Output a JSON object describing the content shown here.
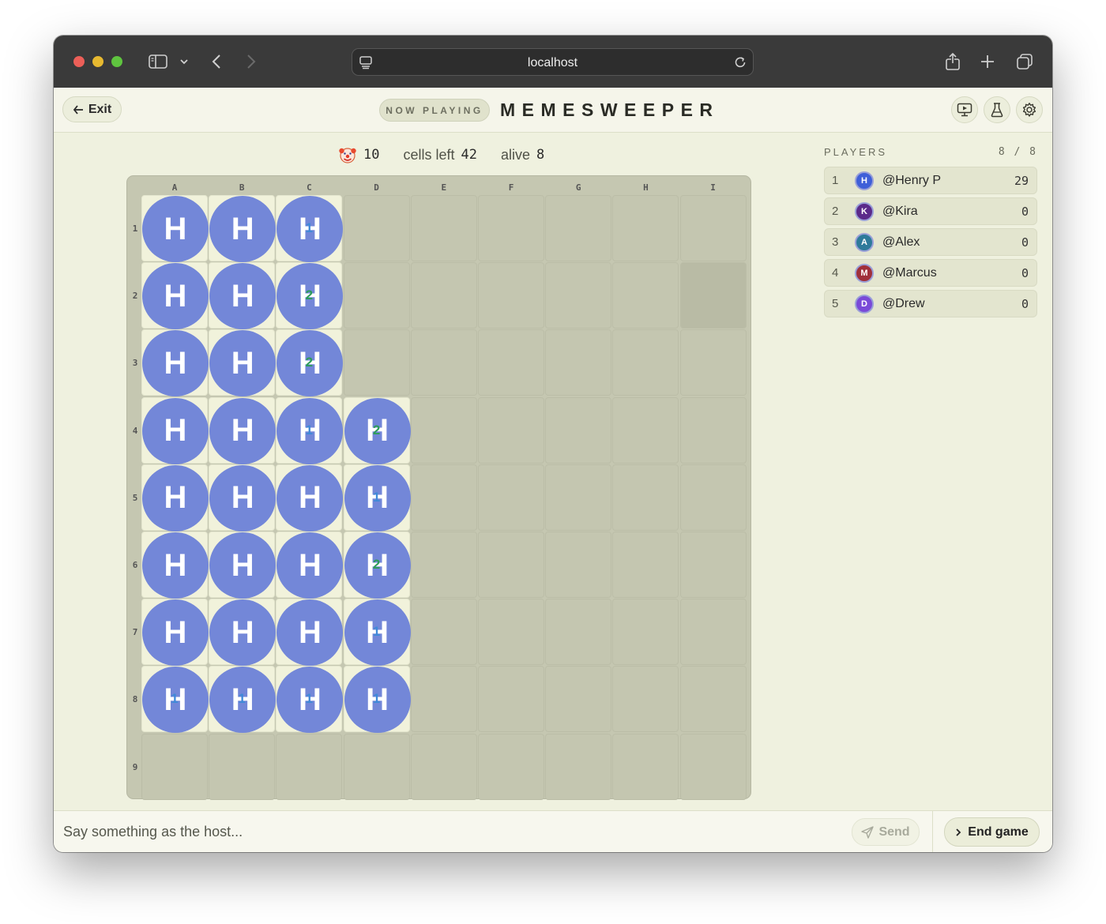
{
  "browser": {
    "url": "localhost"
  },
  "header": {
    "exit_label": "Exit",
    "badge": "NOW PLAYING",
    "title": "MEMESWEEPER"
  },
  "stats": {
    "mines_icon": "clown-face-icon",
    "mines": "10",
    "cells_left_label": "cells left",
    "cells_left": "42",
    "alive_label": "alive",
    "alive": "8"
  },
  "board": {
    "columns": [
      "A",
      "B",
      "C",
      "D",
      "E",
      "F",
      "G",
      "H",
      "I"
    ],
    "rows": [
      "1",
      "2",
      "3",
      "4",
      "5",
      "6",
      "7",
      "8",
      "9"
    ],
    "revealed_marker": "H",
    "revealed_color": "#7387d8",
    "revealed": [
      {
        "col": 0,
        "row": 0,
        "n": ""
      },
      {
        "col": 1,
        "row": 0,
        "n": ""
      },
      {
        "col": 2,
        "row": 0,
        "n": "1"
      },
      {
        "col": 0,
        "row": 1,
        "n": ""
      },
      {
        "col": 1,
        "row": 1,
        "n": ""
      },
      {
        "col": 2,
        "row": 1,
        "n": "2"
      },
      {
        "col": 0,
        "row": 2,
        "n": ""
      },
      {
        "col": 1,
        "row": 2,
        "n": ""
      },
      {
        "col": 2,
        "row": 2,
        "n": "2"
      },
      {
        "col": 0,
        "row": 3,
        "n": ""
      },
      {
        "col": 1,
        "row": 3,
        "n": ""
      },
      {
        "col": 2,
        "row": 3,
        "n": "1"
      },
      {
        "col": 3,
        "row": 3,
        "n": "2"
      },
      {
        "col": 0,
        "row": 4,
        "n": ""
      },
      {
        "col": 1,
        "row": 4,
        "n": ""
      },
      {
        "col": 2,
        "row": 4,
        "n": ""
      },
      {
        "col": 3,
        "row": 4,
        "n": "1"
      },
      {
        "col": 0,
        "row": 5,
        "n": ""
      },
      {
        "col": 1,
        "row": 5,
        "n": ""
      },
      {
        "col": 2,
        "row": 5,
        "n": ""
      },
      {
        "col": 3,
        "row": 5,
        "n": "2"
      },
      {
        "col": 0,
        "row": 6,
        "n": ""
      },
      {
        "col": 1,
        "row": 6,
        "n": ""
      },
      {
        "col": 2,
        "row": 6,
        "n": ""
      },
      {
        "col": 3,
        "row": 6,
        "n": "1"
      },
      {
        "col": 0,
        "row": 7,
        "n": "1"
      },
      {
        "col": 1,
        "row": 7,
        "n": "1"
      },
      {
        "col": 2,
        "row": 7,
        "n": "1"
      },
      {
        "col": 3,
        "row": 7,
        "n": "1"
      }
    ],
    "number_colors": {
      "1": "#3f8ad8",
      "2": "#2e9d59"
    }
  },
  "players": {
    "heading": "PLAYERS",
    "count": "8 / 8",
    "list": [
      {
        "rank": "1",
        "initial": "H",
        "name": "@Henry P",
        "score": "29",
        "color": "#3f5fd8"
      },
      {
        "rank": "2",
        "initial": "K",
        "name": "@Kira",
        "score": "0",
        "color": "#5b2a8a"
      },
      {
        "rank": "3",
        "initial": "A",
        "name": "@Alex",
        "score": "0",
        "color": "#2e7a9a"
      },
      {
        "rank": "4",
        "initial": "M",
        "name": "@Marcus",
        "score": "0",
        "color": "#a0303a"
      },
      {
        "rank": "5",
        "initial": "D",
        "name": "@Drew",
        "score": "0",
        "color": "#7a4ad8"
      }
    ]
  },
  "footer": {
    "chat_placeholder": "Say something as the host...",
    "send_label": "Send",
    "end_label": "End game"
  }
}
